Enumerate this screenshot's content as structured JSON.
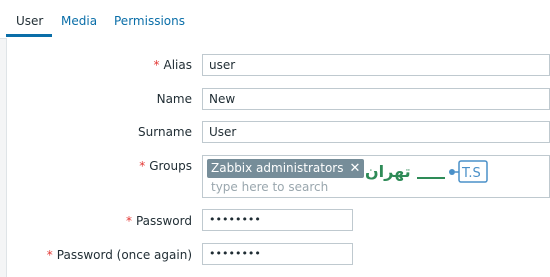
{
  "tabs": [
    {
      "label": "User"
    },
    {
      "label": "Media"
    },
    {
      "label": "Permissions"
    }
  ],
  "form": {
    "alias": {
      "label": "Alias",
      "required": "*",
      "value": "user"
    },
    "name": {
      "label": "Name",
      "value": "New"
    },
    "surname": {
      "label": "Surname",
      "value": "User"
    },
    "groups": {
      "label": "Groups",
      "required": "*",
      "tag": "Zabbix administrators",
      "tag_remove": "✕",
      "placeholder": "type here to search"
    },
    "password": {
      "label": "Password",
      "required": "*",
      "value": "••••••••"
    },
    "password_again": {
      "label": "Password (once again)",
      "required": "*",
      "value": "••••••••"
    }
  },
  "watermark": {
    "text": "T.S",
    "script_text": "تهران"
  },
  "colors": {
    "accent": "#0a6ea8",
    "required": "#e33734",
    "tag_bg": "#768d99",
    "watermark_green": "#2e8b57"
  }
}
